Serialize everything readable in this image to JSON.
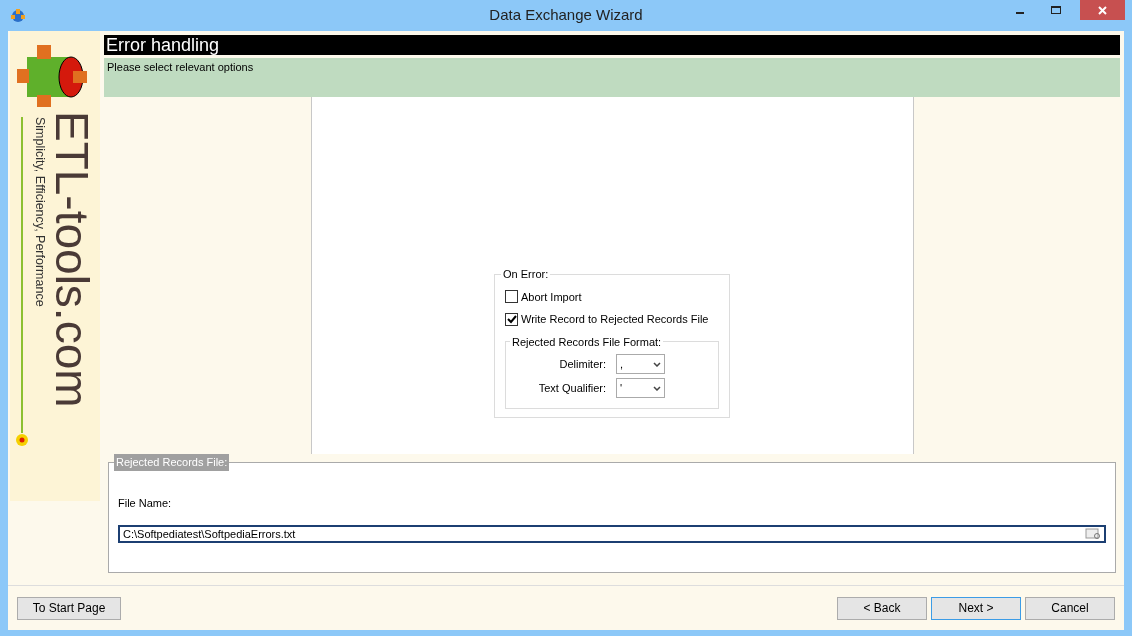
{
  "window": {
    "title": "Data Exchange Wizard"
  },
  "logo": {
    "name": "ETL-tools.com",
    "tagline": "Simplicity, Efficiency, Performance"
  },
  "header": {
    "title": "Error handling",
    "subtitle": "Please select relevant options"
  },
  "on_error": {
    "legend": "On Error:",
    "options": [
      {
        "label": "Abort Import",
        "checked": false
      },
      {
        "label": "Write Record to Rejected Records File",
        "checked": true
      }
    ],
    "format": {
      "legend": "Rejected Records File Format:",
      "fields": [
        {
          "label": "Delimiter:",
          "value": ","
        },
        {
          "label": "Text Qualifier:",
          "value": "'"
        }
      ]
    }
  },
  "rejected_file": {
    "legend": "Rejected Records File:",
    "label": "File Name:",
    "value": "C:\\Softpediatest\\SoftpediaErrors.txt"
  },
  "buttons": {
    "left": [
      {
        "label": "To Start Page",
        "focused": false
      }
    ],
    "right": [
      {
        "label": "< Back",
        "focused": false
      },
      {
        "label": "Next >",
        "focused": true
      },
      {
        "label": "Cancel",
        "focused": false
      }
    ]
  }
}
